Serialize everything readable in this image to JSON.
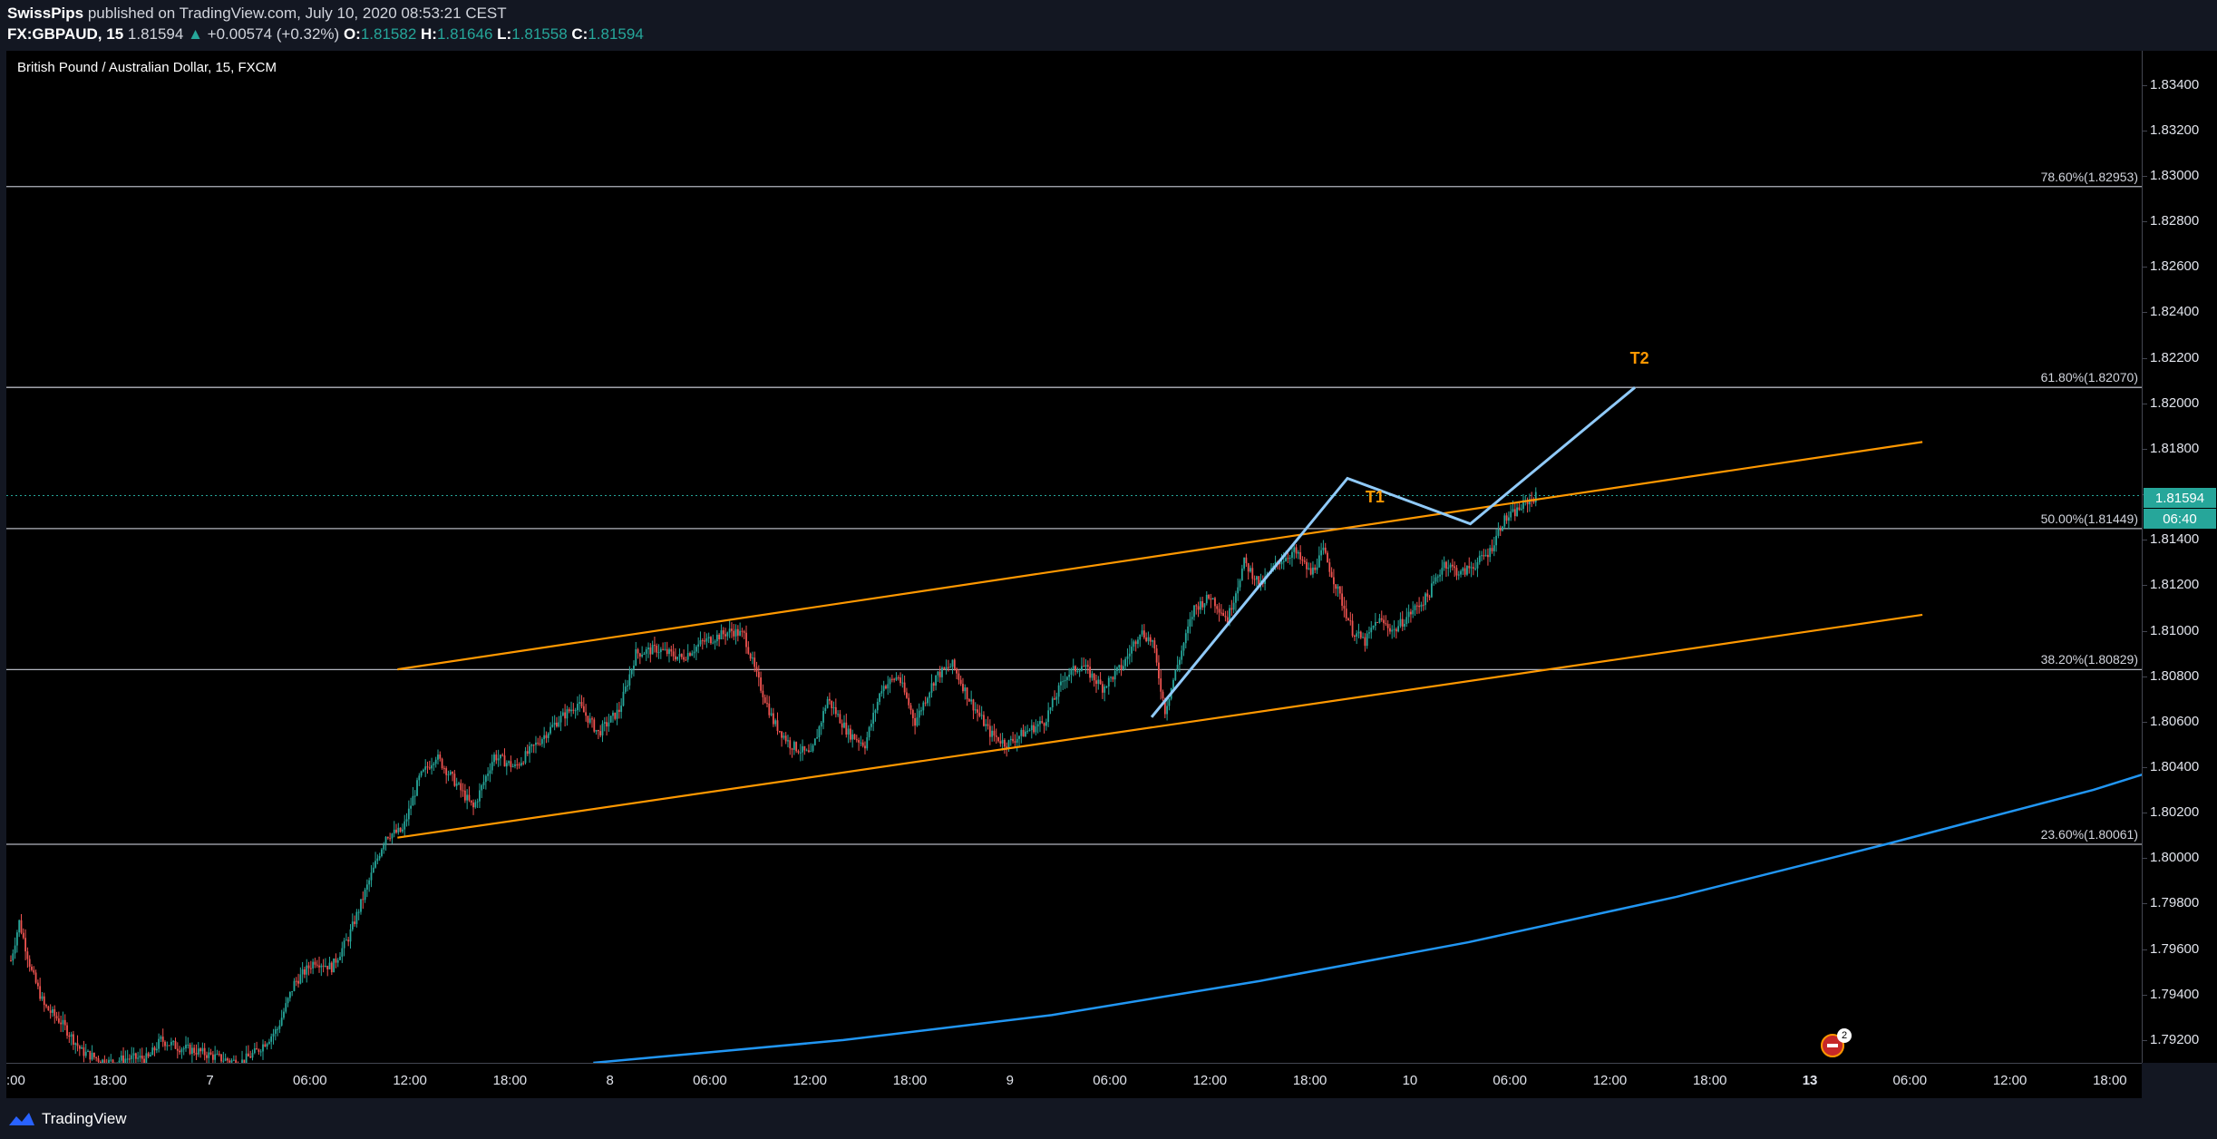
{
  "header": {
    "author": "SwissPips",
    "published_text": "published on TradingView.com, July 10, 2020 08:53:21 CEST",
    "symbol": "FX:GBPAUD, 15",
    "last_price": "1.81594",
    "change_arrow": "▲",
    "change": "+0.00574 (+0.32%)",
    "open_label": "O:",
    "open": "1.81582",
    "high_label": "H:",
    "high": "1.81646",
    "low_label": "L:",
    "low": "1.81558",
    "close_label": "C:",
    "close": "1.81594"
  },
  "pane_title": "British Pound / Australian Dollar, 15, FXCM",
  "current_price_tag": "1.81594",
  "countdown_tag": "06:40",
  "footer": {
    "logo_text": "TradingView",
    "logo_icon": "tradingview-cloud-icon"
  },
  "event_marker": {
    "count": "2",
    "icon": "uk-flag-icon"
  },
  "colors": {
    "up": "#26a69a",
    "down": "#ef5350",
    "channel": "#ff9800",
    "projection": "#90caf9",
    "curve": "#2196f3",
    "fib": "#b2b5be",
    "background": "#000000"
  },
  "chart_data": {
    "type": "candlestick",
    "title": "British Pound / Australian Dollar, 15, FXCM",
    "ylim": [
      1.791,
      1.8355
    ],
    "y_ticks": [
      "1.83400",
      "1.83200",
      "1.83000",
      "1.82800",
      "1.82600",
      "1.82400",
      "1.82200",
      "1.82000",
      "1.81800",
      "1.81600",
      "1.81400",
      "1.81200",
      "1.81000",
      "1.80800",
      "1.80600",
      "1.80400",
      "1.80200",
      "1.80000",
      "1.79800",
      "1.79600",
      "1.79400",
      "1.79200"
    ],
    "x_range_bars": [
      0,
      1056
    ],
    "x_ticks": [
      {
        "bar": 0,
        "label": ":00"
      },
      {
        "bar": 48,
        "label": "18:00"
      },
      {
        "bar": 96,
        "label": "7"
      },
      {
        "bar": 144,
        "label": "06:00"
      },
      {
        "bar": 192,
        "label": "12:00"
      },
      {
        "bar": 240,
        "label": "18:00"
      },
      {
        "bar": 288,
        "label": "8"
      },
      {
        "bar": 336,
        "label": "06:00"
      },
      {
        "bar": 384,
        "label": "12:00"
      },
      {
        "bar": 432,
        "label": "18:00"
      },
      {
        "bar": 480,
        "label": "9"
      },
      {
        "bar": 528,
        "label": "06:00"
      },
      {
        "bar": 576,
        "label": "12:00"
      },
      {
        "bar": 624,
        "label": "18:00"
      },
      {
        "bar": 672,
        "label": "10"
      },
      {
        "bar": 720,
        "label": "06:00"
      },
      {
        "bar": 768,
        "label": "12:00"
      },
      {
        "bar": 816,
        "label": "18:00"
      },
      {
        "bar": 864,
        "label": "13",
        "bold": true
      },
      {
        "bar": 912,
        "label": "06:00"
      },
      {
        "bar": 960,
        "label": "12:00"
      },
      {
        "bar": 1008,
        "label": "18:00"
      }
    ],
    "price_path_keypoints": [
      [
        0,
        1.7955
      ],
      [
        4,
        1.7972
      ],
      [
        10,
        1.795
      ],
      [
        16,
        1.7935
      ],
      [
        24,
        1.7928
      ],
      [
        34,
        1.7915
      ],
      [
        46,
        1.791
      ],
      [
        56,
        1.7912
      ],
      [
        66,
        1.7912
      ],
      [
        72,
        1.792
      ],
      [
        80,
        1.7917
      ],
      [
        90,
        1.7915
      ],
      [
        100,
        1.7912
      ],
      [
        110,
        1.791
      ],
      [
        118,
        1.7915
      ],
      [
        128,
        1.7925
      ],
      [
        136,
        1.7945
      ],
      [
        146,
        1.7955
      ],
      [
        154,
        1.7952
      ],
      [
        162,
        1.7965
      ],
      [
        170,
        1.7985
      ],
      [
        180,
        1.801
      ],
      [
        188,
        1.8012
      ],
      [
        196,
        1.8035
      ],
      [
        204,
        1.8045
      ],
      [
        212,
        1.8035
      ],
      [
        222,
        1.8022
      ],
      [
        232,
        1.8045
      ],
      [
        242,
        1.804
      ],
      [
        252,
        1.805
      ],
      [
        262,
        1.806
      ],
      [
        272,
        1.8068
      ],
      [
        282,
        1.8055
      ],
      [
        292,
        1.8065
      ],
      [
        300,
        1.809
      ],
      [
        310,
        1.8092
      ],
      [
        322,
        1.8088
      ],
      [
        332,
        1.8095
      ],
      [
        346,
        1.81
      ],
      [
        352,
        1.8098
      ],
      [
        358,
        1.808
      ],
      [
        366,
        1.806
      ],
      [
        374,
        1.805
      ],
      [
        384,
        1.8045
      ],
      [
        392,
        1.807
      ],
      [
        402,
        1.8055
      ],
      [
        410,
        1.805
      ],
      [
        418,
        1.8075
      ],
      [
        426,
        1.808
      ],
      [
        434,
        1.806
      ],
      [
        444,
        1.808
      ],
      [
        452,
        1.8085
      ],
      [
        460,
        1.807
      ],
      [
        470,
        1.8055
      ],
      [
        478,
        1.805
      ],
      [
        486,
        1.8055
      ],
      [
        496,
        1.806
      ],
      [
        506,
        1.808
      ],
      [
        514,
        1.8085
      ],
      [
        524,
        1.8075
      ],
      [
        534,
        1.8085
      ],
      [
        542,
        1.81
      ],
      [
        548,
        1.8095
      ],
      [
        554,
        1.8065
      ],
      [
        560,
        1.8085
      ],
      [
        568,
        1.811
      ],
      [
        576,
        1.8115
      ],
      [
        584,
        1.8105
      ],
      [
        592,
        1.813
      ],
      [
        600,
        1.812
      ],
      [
        608,
        1.813
      ],
      [
        616,
        1.8135
      ],
      [
        624,
        1.8125
      ],
      [
        630,
        1.8135
      ],
      [
        636,
        1.812
      ],
      [
        644,
        1.81
      ],
      [
        650,
        1.8095
      ],
      [
        656,
        1.8105
      ],
      [
        664,
        1.81
      ],
      [
        672,
        1.8108
      ],
      [
        680,
        1.8115
      ],
      [
        688,
        1.813
      ],
      [
        696,
        1.8125
      ],
      [
        704,
        1.813
      ],
      [
        710,
        1.8135
      ],
      [
        716,
        1.8148
      ],
      [
        722,
        1.8152
      ],
      [
        728,
        1.8157
      ],
      [
        732,
        1.8159
      ]
    ],
    "fibonacci": [
      {
        "label": "78.60%(1.82953)",
        "price": 1.82953
      },
      {
        "label": "61.80%(1.82070)",
        "price": 1.8207
      },
      {
        "label": "50.00%(1.81449)",
        "price": 1.81449
      },
      {
        "label": "38.20%(1.80829)",
        "price": 1.80829
      },
      {
        "label": "23.60%(1.80061)",
        "price": 1.80061
      }
    ],
    "current_price": 1.81594,
    "channel_upper": [
      [
        186,
        1.8083
      ],
      [
        918,
        1.8183
      ]
    ],
    "channel_lower": [
      [
        186,
        1.8009
      ],
      [
        918,
        1.8107
      ]
    ],
    "projection_path": [
      [
        548,
        1.8062
      ],
      [
        642,
        1.8167
      ],
      [
        701,
        1.8147
      ],
      [
        780,
        1.8207
      ]
    ],
    "projection_labels": [
      {
        "text": "T1",
        "bar": 655,
        "price": 1.8158
      },
      {
        "text": "T2",
        "bar": 782,
        "price": 1.8219
      }
    ],
    "moving_average_curve": [
      [
        280,
        1.791
      ],
      [
        400,
        1.792
      ],
      [
        500,
        1.7931
      ],
      [
        600,
        1.7946
      ],
      [
        700,
        1.7963
      ],
      [
        800,
        1.7983
      ],
      [
        900,
        1.8006
      ],
      [
        1000,
        1.803
      ],
      [
        1056,
        1.8046
      ]
    ]
  }
}
